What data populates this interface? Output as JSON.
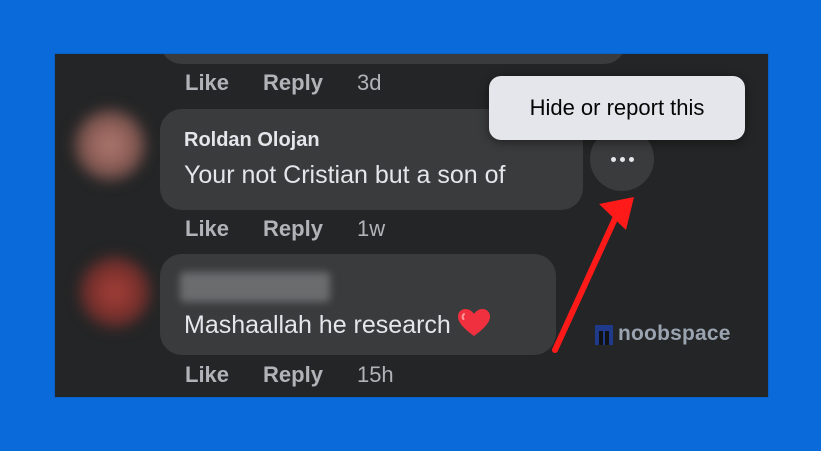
{
  "previous_comment": {
    "actions": {
      "like": "Like",
      "reply": "Reply",
      "time": "3d"
    }
  },
  "comment1": {
    "author": "Roldan Olojan",
    "text": "Your not Cristian but a son of",
    "actions": {
      "like": "Like",
      "reply": "Reply",
      "time": "1w"
    }
  },
  "comment2": {
    "text": "Mashaallah he research",
    "reaction_emoji": "heart",
    "actions": {
      "like": "Like",
      "reply": "Reply",
      "time": "15h"
    }
  },
  "menu": {
    "more_icon": "more-horizontal-icon",
    "tooltip": "Hide or report this"
  },
  "watermark": {
    "text": "noobspace"
  },
  "colors": {
    "background": "#0a6ada",
    "panel": "#242526",
    "bubble": "#3a3b3c",
    "arrow": "#ff1a1a"
  }
}
